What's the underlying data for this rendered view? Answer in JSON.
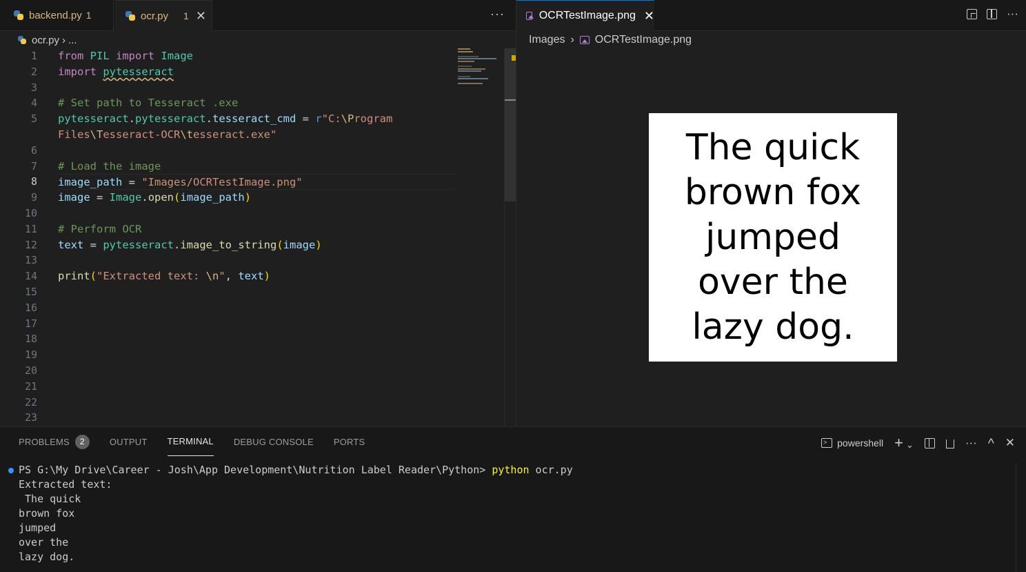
{
  "left_editor": {
    "tabs": [
      {
        "label": "backend.py",
        "badge": "1"
      },
      {
        "label": "ocr.py",
        "badge": "1",
        "close": "✕"
      }
    ],
    "more": "···",
    "breadcrumb": {
      "file": "ocr.py",
      "sep": "›",
      "rest": "..."
    },
    "line_numbers": [
      "1",
      "2",
      "3",
      "4",
      "5",
      "",
      "6",
      "7",
      "8",
      "9",
      "10",
      "11",
      "12",
      "13",
      "14",
      "15",
      "16",
      "17",
      "18",
      "19",
      "20",
      "21",
      "22",
      "23"
    ],
    "current_line": "8",
    "code": {
      "l1": [
        "from",
        "PIL",
        "import",
        "Image"
      ],
      "l2": [
        "import",
        "pytesseract"
      ],
      "l4": "# Set path to Tesseract .exe",
      "l5a": [
        "pytesseract",
        ".",
        "pytesseract",
        ".",
        "tesseract_cmd",
        " = ",
        "r",
        "\"C:",
        "\\P",
        "rogram"
      ],
      "l5b": [
        "Files",
        "\\T",
        "esseract-OCR",
        "\\t",
        "esseract.exe\""
      ],
      "l7": "# Load the image",
      "l8": [
        "image_path",
        " = ",
        "\"Images/OCRTestImage.png\""
      ],
      "l9": [
        "image",
        " = ",
        "Image",
        ".",
        "open",
        "(",
        "image_path",
        ")"
      ],
      "l11": "# Perform OCR",
      "l12": [
        "text",
        " = ",
        "pytesseract",
        ".",
        "image_to_string",
        "(",
        "image",
        ")"
      ],
      "l14": [
        "print",
        "(",
        "\"Extracted text: ",
        "\\n",
        "\"",
        ", ",
        "text",
        ")"
      ]
    }
  },
  "right_editor": {
    "tab": {
      "label": "OCRTestImage.png",
      "close": "✕"
    },
    "more": "···",
    "breadcrumb": {
      "folder": "Images",
      "sep": "›",
      "file": "OCRTestImage.png"
    },
    "image_text": [
      "The quick",
      "brown fox",
      "jumped",
      "over the",
      "lazy dog."
    ]
  },
  "panel": {
    "tabs": [
      {
        "label": "PROBLEMS",
        "badge": "2"
      },
      {
        "label": "OUTPUT"
      },
      {
        "label": "TERMINAL",
        "active": true
      },
      {
        "label": "DEBUG CONSOLE"
      },
      {
        "label": "PORTS"
      }
    ],
    "shell": "powershell",
    "add": "+",
    "chevron": "⌄",
    "more": "···",
    "maximize": "^",
    "close": "✕",
    "terminal": {
      "prompt": "PS G:\\My Drive\\Career - Josh\\App Development\\Nutrition Label Reader\\Python> ",
      "cmd": "python",
      "arg": " ocr.py",
      "output": [
        "Extracted text:",
        " The quick",
        "brown fox",
        "jumped",
        "over the",
        "lazy dog."
      ]
    }
  },
  "colors": {
    "editor_bg": "#1f1f1f",
    "tabbar_bg": "#181818",
    "accent": "#0078d4",
    "keyword": "#c586c0",
    "string": "#ce9178",
    "comment": "#6a9955",
    "variable": "#9cdcfe",
    "class": "#4ec9b0",
    "function": "#dcdcaa"
  }
}
